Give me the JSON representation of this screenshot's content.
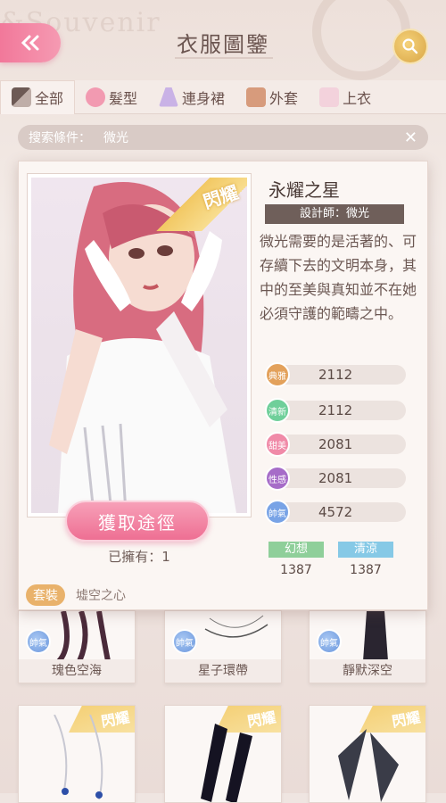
{
  "header": {
    "bg_word": "&Souvenir",
    "title": "衣服圖鑒"
  },
  "tabs": [
    {
      "label": "全部",
      "active": true
    },
    {
      "label": "髮型",
      "active": false
    },
    {
      "label": "連身裙",
      "active": false
    },
    {
      "label": "外套",
      "active": false
    },
    {
      "label": "上衣",
      "active": false
    }
  ],
  "filter": {
    "label": "搜索條件：",
    "value": "微光"
  },
  "detail": {
    "badge": "閃耀",
    "name": "永耀之星",
    "designer": "設計師：微光",
    "description": "微光需要的是活著的、可存續下去的文明本身，其中的至美與真知並不在她必須守護的範疇之中。",
    "get_button": "獲取途徑",
    "owned": "已擁有：1",
    "suit_tag": "套裝",
    "suit_name": "墟空之心",
    "stats": [
      {
        "label": "典雅",
        "value": "2112",
        "color": "#e3a15b"
      },
      {
        "label": "清新",
        "value": "2112",
        "color": "#6fcf9a"
      },
      {
        "label": "甜美",
        "value": "2081",
        "color": "#f08aa8"
      },
      {
        "label": "性感",
        "value": "2081",
        "color": "#a66cc8"
      },
      {
        "label": "帥氣",
        "value": "4572",
        "color": "#78a3e6"
      }
    ],
    "tags": [
      {
        "label": "幻想",
        "value": "1387",
        "color": "#8fcf9a"
      },
      {
        "label": "清涼",
        "value": "1387",
        "color": "#86c9e6"
      }
    ]
  },
  "grid_row1": [
    {
      "badge": "帥氣",
      "name": "瑰色空海"
    },
    {
      "badge": "帥氣",
      "name": "星子環帶"
    },
    {
      "badge": "帥氣",
      "name": "靜默深空"
    }
  ],
  "grid_row2": [
    {
      "badge": "閃耀"
    },
    {
      "badge": "閃耀"
    },
    {
      "badge": "閃耀"
    }
  ]
}
